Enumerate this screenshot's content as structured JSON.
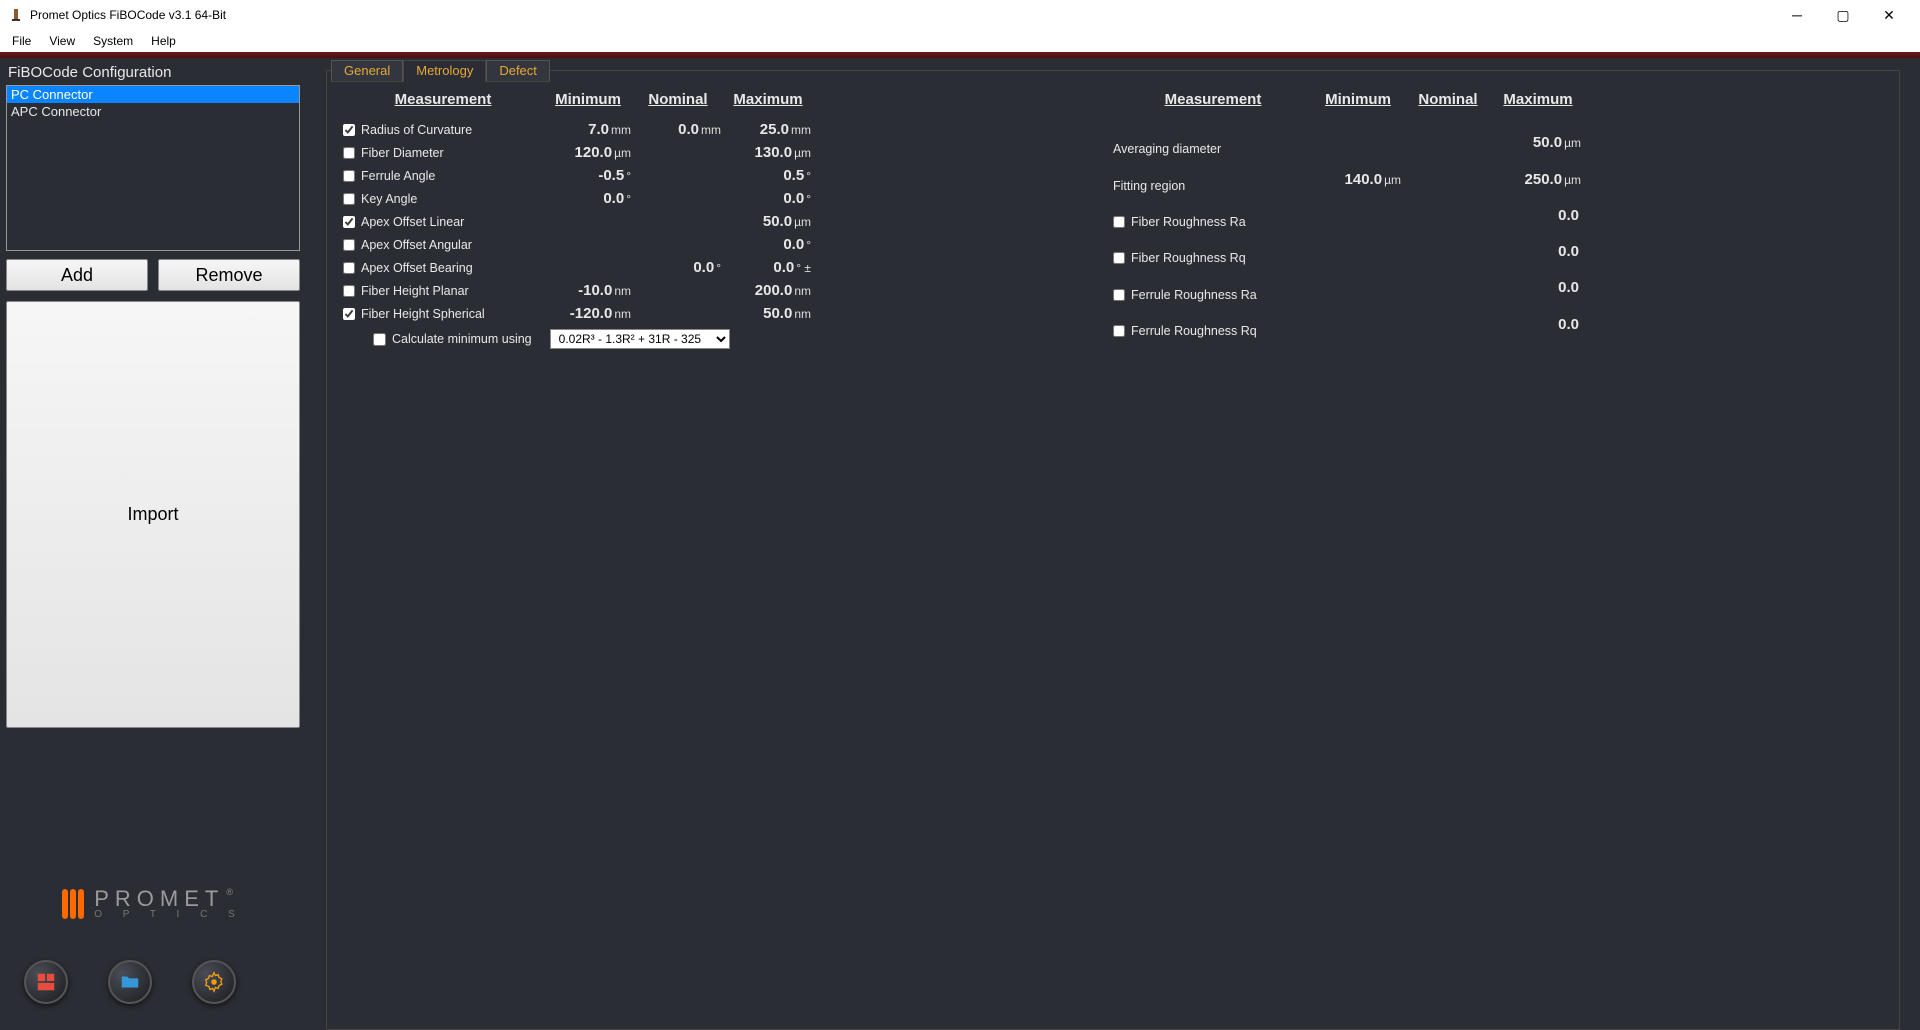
{
  "window": {
    "title": "Promet Optics FiBOCode v3.1 64-Bit"
  },
  "menu": {
    "file": "File",
    "view": "View",
    "system": "System",
    "help": "Help"
  },
  "sidebar": {
    "title": "FiBOCode Configuration",
    "items": [
      "PC Connector",
      "APC Connector"
    ],
    "add": "Add",
    "remove": "Remove",
    "import": "Import"
  },
  "tabs": {
    "general": "General",
    "metrology": "Metrology",
    "defect": "Defect"
  },
  "headers": {
    "measurement": "Measurement",
    "minimum": "Minimum",
    "nominal": "Nominal",
    "maximum": "Maximum"
  },
  "left_rows": [
    {
      "checked": true,
      "label": "Radius of Curvature",
      "min": "7.0",
      "min_u": "mm",
      "nom": "0.0",
      "nom_u": "mm",
      "max": "25.0",
      "max_u": "mm"
    },
    {
      "checked": false,
      "label": "Fiber Diameter",
      "min": "120.0",
      "min_u": "µm",
      "nom": "",
      "nom_u": "",
      "max": "130.0",
      "max_u": "µm"
    },
    {
      "checked": false,
      "label": "Ferrule Angle",
      "min": "-0.5",
      "min_u": "°",
      "nom": "",
      "nom_u": "",
      "max": "0.5",
      "max_u": "°"
    },
    {
      "checked": false,
      "label": "Key Angle",
      "min": "0.0",
      "min_u": "°",
      "nom": "",
      "nom_u": "",
      "max": "0.0",
      "max_u": "°"
    },
    {
      "checked": true,
      "label": "Apex Offset Linear",
      "min": "",
      "min_u": "",
      "nom": "",
      "nom_u": "",
      "max": "50.0",
      "max_u": "µm"
    },
    {
      "checked": false,
      "label": "Apex Offset Angular",
      "min": "",
      "min_u": "",
      "nom": "",
      "nom_u": "",
      "max": "0.0",
      "max_u": "°"
    },
    {
      "checked": false,
      "label": "Apex Offset Bearing",
      "min": "",
      "min_u": "",
      "nom": "0.0",
      "nom_u": "°",
      "max": "0.0",
      "max_u": "° ±"
    },
    {
      "checked": false,
      "label": "Fiber Height Planar",
      "min": "-10.0",
      "min_u": "nm",
      "nom": "",
      "nom_u": "",
      "max": "200.0",
      "max_u": "nm"
    },
    {
      "checked": true,
      "label": "Fiber Height Spherical",
      "min": "-120.0",
      "min_u": "nm",
      "nom": "",
      "nom_u": "",
      "max": "50.0",
      "max_u": "nm"
    }
  ],
  "calc": {
    "label": "Calculate minimum using",
    "value": "0.02R³ - 1.3R² + 31R - 325"
  },
  "right_rows": [
    {
      "checkbox": false,
      "checked": false,
      "label": "Averaging diameter",
      "min": "",
      "min_u": "",
      "max": "50.0",
      "max_u": "µm"
    },
    {
      "checkbox": false,
      "checked": false,
      "label": "Fitting region",
      "min": "140.0",
      "min_u": "µm",
      "max": "250.0",
      "max_u": "µm"
    },
    {
      "checkbox": true,
      "checked": false,
      "label": "Fiber Roughness Ra",
      "min": "",
      "min_u": "",
      "max": "0.0",
      "max_u": ""
    },
    {
      "checkbox": true,
      "checked": false,
      "label": "Fiber Roughness Rq",
      "min": "",
      "min_u": "",
      "max": "0.0",
      "max_u": ""
    },
    {
      "checkbox": true,
      "checked": false,
      "label": "Ferrule Roughness Ra",
      "min": "",
      "min_u": "",
      "max": "0.0",
      "max_u": ""
    },
    {
      "checkbox": true,
      "checked": false,
      "label": "Ferrule Roughness Rq",
      "min": "",
      "min_u": "",
      "max": "0.0",
      "max_u": ""
    }
  ],
  "logo": {
    "top": "PROMET",
    "bottom": "O P T I C S",
    "reg": "®"
  }
}
